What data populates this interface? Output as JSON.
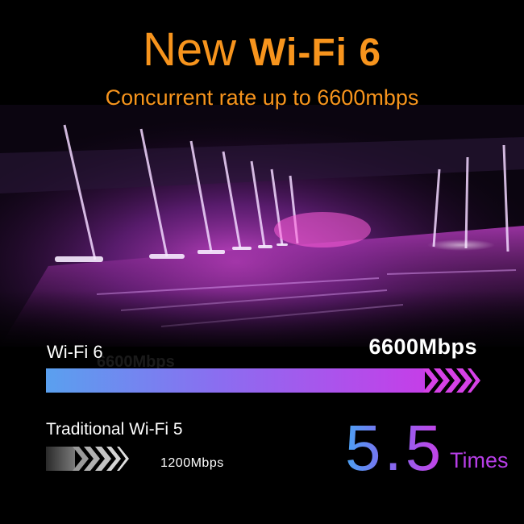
{
  "headline": {
    "lead": "New",
    "strong": "Wi-Fi 6"
  },
  "subheadline": "Concurrent rate up to 6600mbps",
  "comparison": {
    "wifi6": {
      "label": "Wi-Fi 6",
      "speed": "6600Mbps",
      "speed_mbps": 6600
    },
    "wifi5": {
      "label": "Traditional Wi-Fi 5",
      "speed": "1200Mbps",
      "speed_mbps": 1200
    }
  },
  "multiplier": {
    "value": "5.5",
    "unit": "Times"
  },
  "colors": {
    "headline": "#f7941d",
    "bar_start": "#5aa0ef",
    "bar_end": "#c53ee8",
    "unit": "#b63ee6",
    "text": "#ffffff",
    "background": "#000000"
  }
}
